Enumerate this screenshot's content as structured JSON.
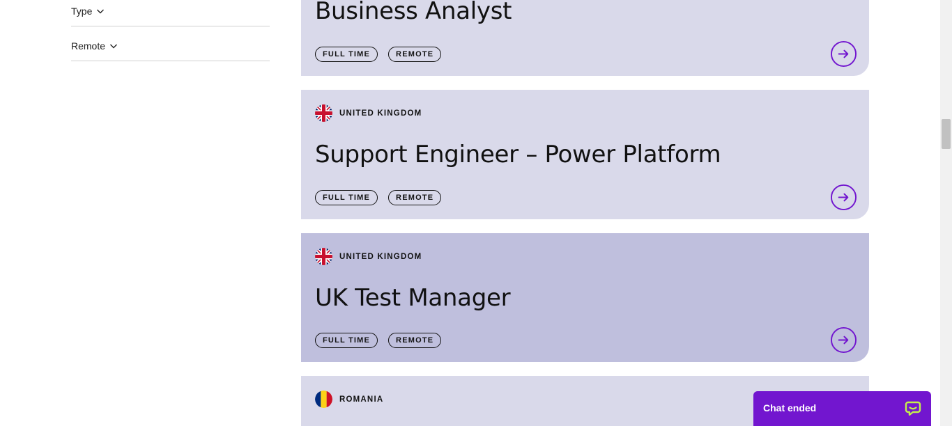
{
  "filters": [
    {
      "label": "Type"
    },
    {
      "label": "Remote"
    }
  ],
  "jobs": [
    {
      "country": "",
      "flag": "",
      "title": "Business Analyst",
      "tags": [
        "FULL TIME",
        "REMOTE"
      ]
    },
    {
      "country": "UNITED KINGDOM",
      "flag": "uk",
      "title": "Support Engineer – Power Platform",
      "tags": [
        "FULL TIME",
        "REMOTE"
      ]
    },
    {
      "country": "UNITED KINGDOM",
      "flag": "uk",
      "title": "UK Test Manager",
      "tags": [
        "FULL TIME",
        "REMOTE"
      ]
    },
    {
      "country": "ROMANIA",
      "flag": "romania",
      "title": "",
      "tags": []
    }
  ],
  "chat": {
    "label": "Chat ended",
    "icon": "chat-bubble-icon"
  },
  "icons": {
    "chevron": "chevron-down-icon",
    "arrow": "arrow-right-circle-icon"
  },
  "colors": {
    "card_bg": "#d9d9ea",
    "card_hover_bg": "#bfbfdd",
    "accent": "#7216cf",
    "chat_bg": "#7216cf"
  }
}
